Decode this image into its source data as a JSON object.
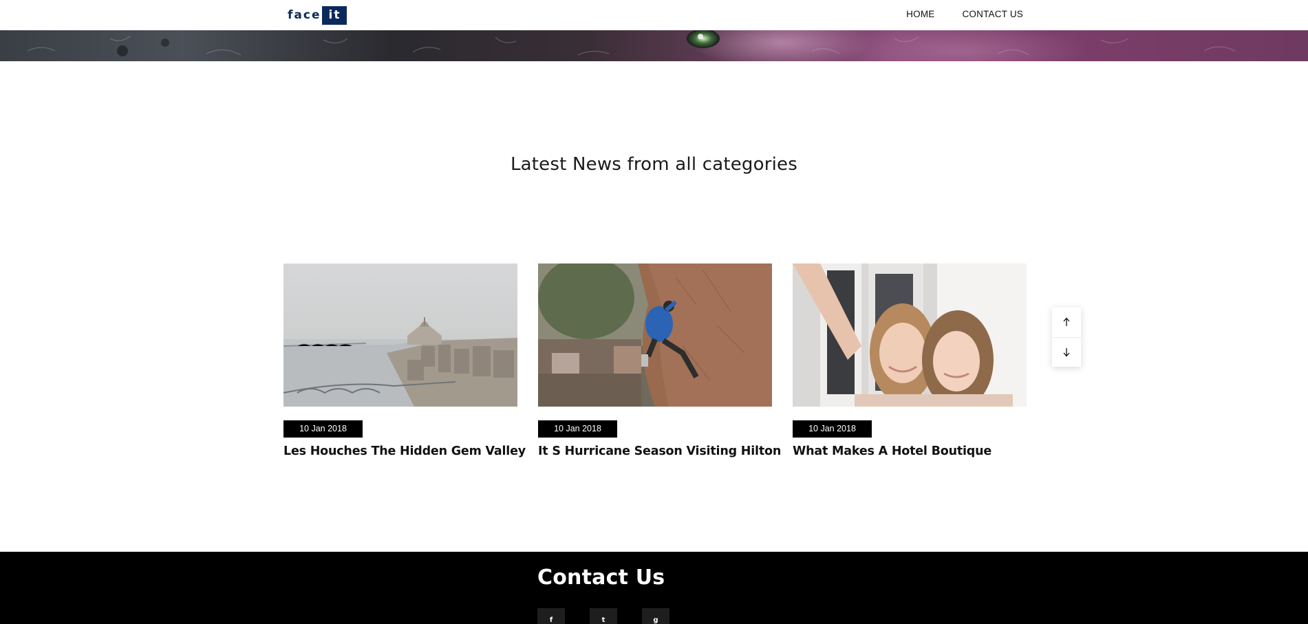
{
  "header": {
    "logo": {
      "part1": "face",
      "part2": "it"
    },
    "nav": [
      {
        "label": "HOME"
      },
      {
        "label": "CONTACT US"
      }
    ]
  },
  "section": {
    "title": "Latest News from all categories"
  },
  "cards": [
    {
      "date": "10 Jan 2018",
      "title": "Les Houches The Hidden Gem Valley"
    },
    {
      "date": "10 Jan 2018",
      "title": "It S Hurricane Season Visiting Hilton"
    },
    {
      "date": "10 Jan 2018",
      "title": "What Makes A Hotel Boutique"
    }
  ],
  "scroll": {
    "up_icon": "arrow-up-icon",
    "down_icon": "arrow-down-icon"
  },
  "footer": {
    "title": "Contact Us",
    "social": [
      {
        "icon": "facebook-icon",
        "glyph": "f"
      },
      {
        "icon": "twitter-icon",
        "glyph": "t"
      },
      {
        "icon": "github-icon",
        "glyph": "g"
      }
    ]
  },
  "colors": {
    "brand": "#0b2a5b",
    "badge": "#000000",
    "footer": "#000000"
  }
}
